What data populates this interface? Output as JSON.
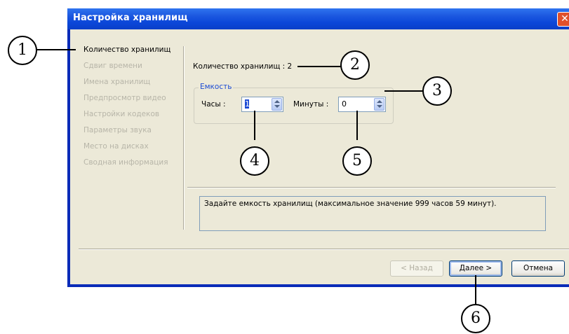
{
  "window": {
    "title": "Настройка хранилищ"
  },
  "nav": {
    "items": [
      {
        "label": "Количество хранилищ",
        "active": true
      },
      {
        "label": "Сдвиг времени",
        "active": false
      },
      {
        "label": "Имена хранилищ",
        "active": false
      },
      {
        "label": "Предпросмотр видео",
        "active": false
      },
      {
        "label": "Настройки кодеков",
        "active": false
      },
      {
        "label": "Параметры звука",
        "active": false
      },
      {
        "label": "Место на дисках",
        "active": false
      },
      {
        "label": "Сводная информация",
        "active": false
      }
    ]
  },
  "main": {
    "count_label": "Количество хранилищ : 2",
    "capacity_group": "Емкость",
    "hours_label": "Часы :",
    "hours_value": "1",
    "minutes_label": "Минуты :",
    "minutes_value": "0",
    "hint": "Задайте емкость хранилищ (максимальное значение 999 часов 59 минут)."
  },
  "buttons": {
    "back": "< Назад",
    "next": "Далее >",
    "cancel": "Отмена"
  },
  "callouts": [
    "1",
    "2",
    "3",
    "4",
    "5",
    "6"
  ],
  "colors": {
    "titlebar": "#0b46d8",
    "client": "#ece9d8",
    "group_title": "#1c4bd4"
  }
}
